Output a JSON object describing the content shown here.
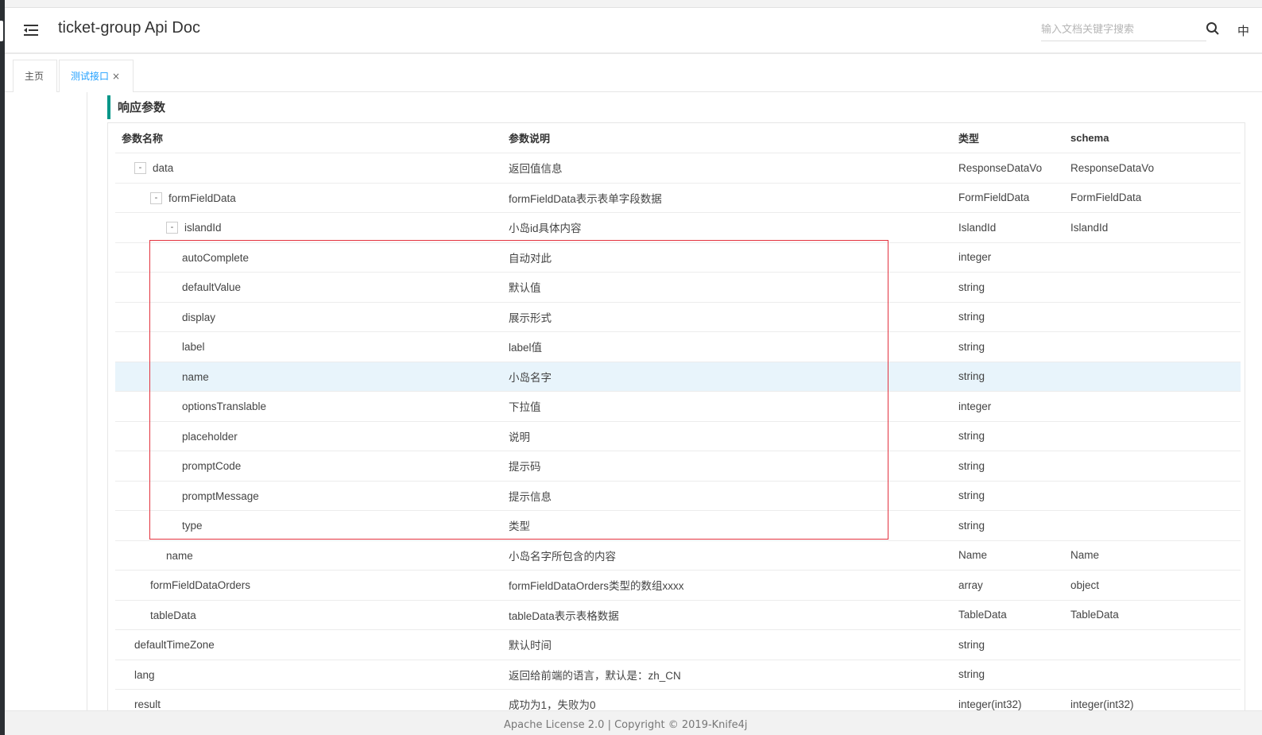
{
  "header": {
    "title": "ticket-group Api Doc",
    "search_placeholder": "输入文档关键字搜索",
    "lang": "中"
  },
  "tabs": [
    {
      "label": "主页",
      "active": false
    },
    {
      "label": "测试接口",
      "active": true,
      "close": "×"
    }
  ],
  "section": {
    "title": "响应参数"
  },
  "table": {
    "headers": [
      "参数名称",
      "参数说明",
      "类型",
      "schema"
    ],
    "rows": [
      {
        "name": "data",
        "desc": "返回值信息",
        "type": "ResponseDataVo",
        "schema": "ResponseDataVo",
        "toggle": "-"
      },
      {
        "name": "formFieldData",
        "desc": "formFieldData表示表单字段数据",
        "type": "FormFieldData",
        "schema": "FormFieldData",
        "toggle": "-"
      },
      {
        "name": "islandId",
        "desc": "小岛id具体内容",
        "type": "IslandId",
        "schema": "IslandId",
        "toggle": "-"
      },
      {
        "name": "autoComplete",
        "desc": "自动对此",
        "type": "integer",
        "schema": ""
      },
      {
        "name": "defaultValue",
        "desc": "默认值",
        "type": "string",
        "schema": ""
      },
      {
        "name": "display",
        "desc": "展示形式",
        "type": "string",
        "schema": ""
      },
      {
        "name": "label",
        "desc": "label值",
        "type": "string",
        "schema": ""
      },
      {
        "name": "name",
        "desc": "小岛名字",
        "type": "string",
        "schema": "",
        "highlight": true
      },
      {
        "name": "optionsTranslable",
        "desc": "下拉值",
        "type": "integer",
        "schema": ""
      },
      {
        "name": "placeholder",
        "desc": "说明",
        "type": "string",
        "schema": ""
      },
      {
        "name": "promptCode",
        "desc": "提示码",
        "type": "string",
        "schema": ""
      },
      {
        "name": "promptMessage",
        "desc": "提示信息",
        "type": "string",
        "schema": ""
      },
      {
        "name": "type",
        "desc": "类型",
        "type": "string",
        "schema": ""
      },
      {
        "name": "name",
        "desc": "小岛名字所包含的内容",
        "type": "Name",
        "schema": "Name"
      },
      {
        "name": "formFieldDataOrders",
        "desc": "formFieldDataOrders类型的数组xxxx",
        "type": "array",
        "schema": "object"
      },
      {
        "name": "tableData",
        "desc": "tableData表示表格数据",
        "type": "TableData",
        "schema": "TableData"
      },
      {
        "name": "defaultTimeZone",
        "desc": "默认时间",
        "type": "string",
        "schema": ""
      },
      {
        "name": "lang",
        "desc": "返回给前端的语言，默认是：zh_CN",
        "type": "string",
        "schema": ""
      },
      {
        "name": "result",
        "desc": "成功为1，失败为0",
        "type": "integer(int32)",
        "schema": "integer(int32)"
      }
    ]
  },
  "footer": {
    "text": "Apache License 2.0 | Copyright © 2019-Knife4j"
  }
}
